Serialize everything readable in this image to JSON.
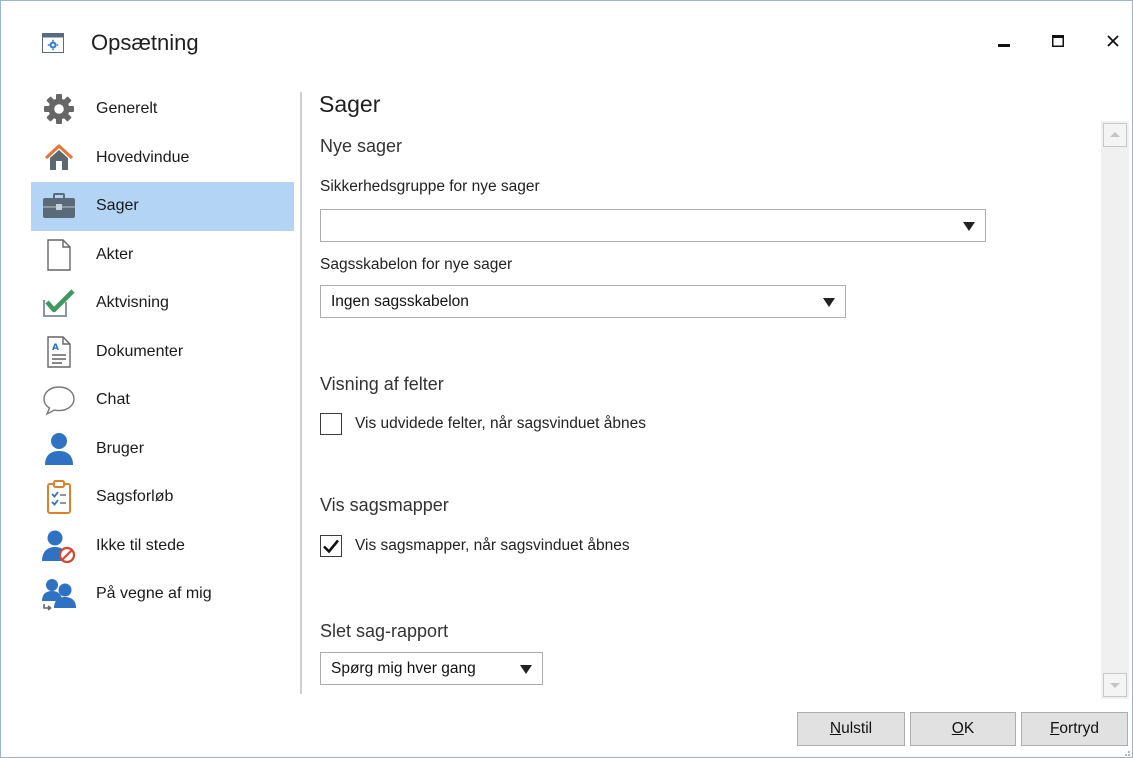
{
  "window": {
    "title": "Opsætning",
    "accent": "#b3d4f5",
    "border": "#9ab4d4"
  },
  "nav": {
    "items": [
      {
        "label": "Generelt",
        "icon": "gear-icon"
      },
      {
        "label": "Hovedvindue",
        "icon": "home-icon"
      },
      {
        "label": "Sager",
        "icon": "briefcase-icon",
        "selected": true
      },
      {
        "label": "Akter",
        "icon": "document-icon"
      },
      {
        "label": "Aktvisning",
        "icon": "checkmark-icon"
      },
      {
        "label": "Dokumenter",
        "icon": "text-document-icon"
      },
      {
        "label": "Chat",
        "icon": "speech-bubble-icon"
      },
      {
        "label": "Bruger",
        "icon": "user-icon"
      },
      {
        "label": "Sagsforløb",
        "icon": "clipboard-checklist-icon"
      },
      {
        "label": "Ikke til stede",
        "icon": "user-away-icon"
      },
      {
        "label": "På vegne af mig",
        "icon": "users-delegate-icon"
      }
    ]
  },
  "content": {
    "title": "Sager",
    "new_cases": {
      "heading": "Nye sager",
      "security_group_label": "Sikkerhedsgruppe for nye sager",
      "security_group_value": "",
      "template_label": "Sagsskabelon for nye sager",
      "template_value": "Ingen sagsskabelon"
    },
    "field_display": {
      "heading": "Visning af felter",
      "checkbox_label": "Vis udvidede felter, når sagsvinduet åbnes",
      "checked": false
    },
    "case_folders": {
      "heading": "Vis sagsmapper",
      "checkbox_label": "Vis sagsmapper, når sagsvinduet åbnes",
      "checked": true
    },
    "delete_report": {
      "heading": "Slet sag-rapport",
      "value": "Spørg mig hver gang"
    }
  },
  "footer": {
    "reset_label_mnemonic": "N",
    "reset_label_rest": "ulstil",
    "ok_label_mnemonic": "O",
    "ok_label_rest": "K",
    "cancel_label_mnemonic": "F",
    "cancel_label_rest": "ortryd"
  }
}
